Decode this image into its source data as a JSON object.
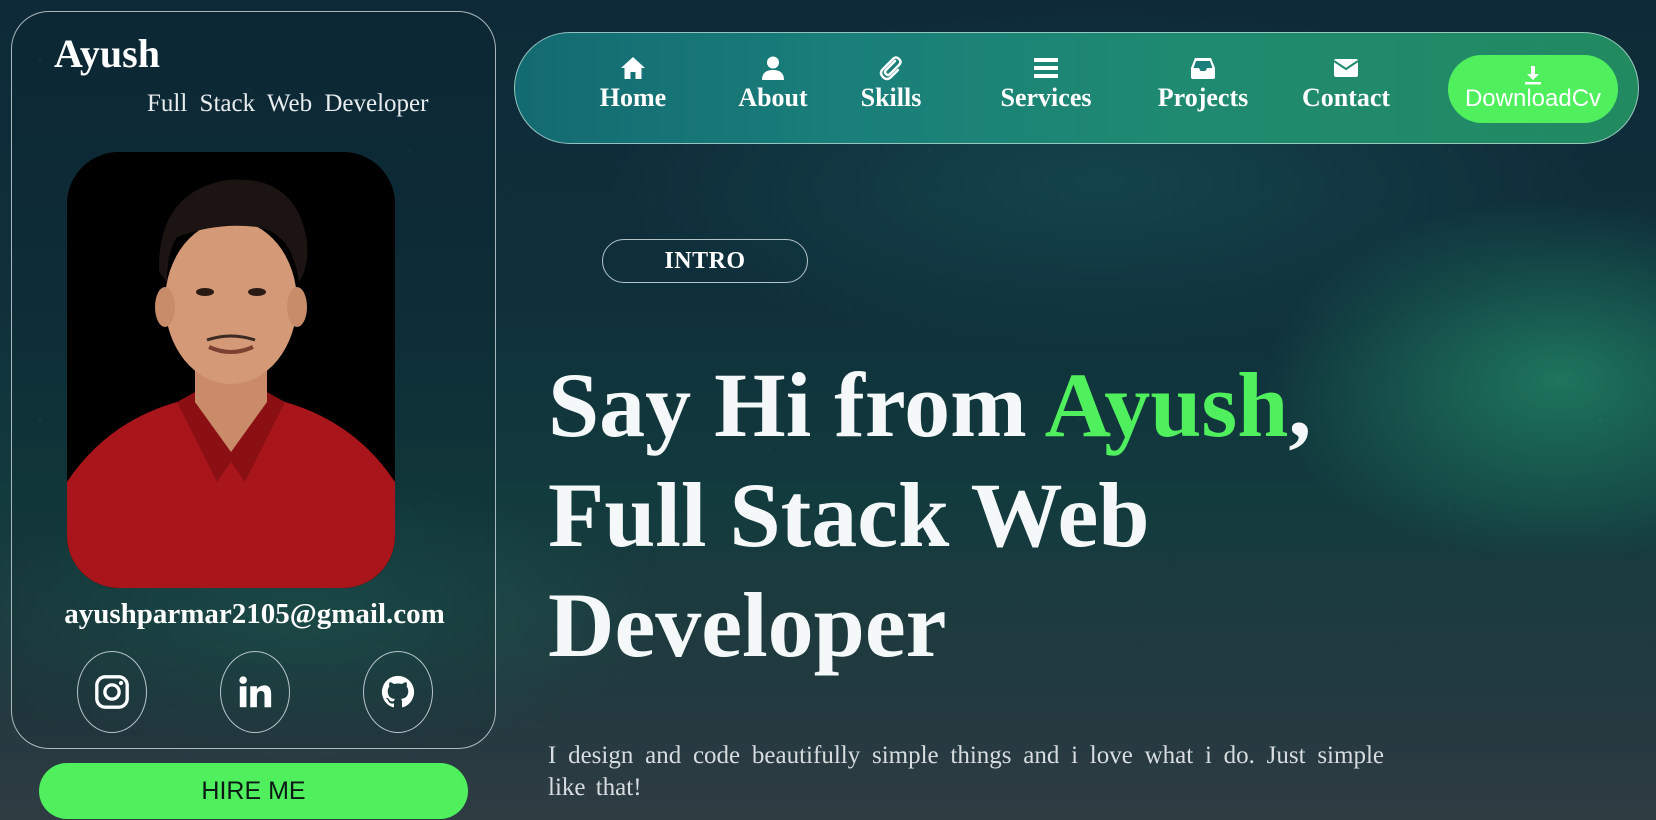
{
  "profile": {
    "name": "Ayush",
    "role": "Full Stack Web Developer",
    "email": "ayushparmar2105@gmail.com",
    "socials": [
      {
        "icon": "instagram-icon"
      },
      {
        "icon": "linkedin-icon"
      },
      {
        "icon": "github-icon"
      }
    ],
    "hire_label": "HIRE ME"
  },
  "nav": {
    "items": [
      {
        "label": "Home",
        "icon": "home-icon"
      },
      {
        "label": "About",
        "icon": "user-icon"
      },
      {
        "label": "Skills",
        "icon": "paperclip-icon"
      },
      {
        "label": "Services",
        "icon": "bars-icon"
      },
      {
        "label": "Projects",
        "icon": "inbox-icon"
      },
      {
        "label": "Contact",
        "icon": "envelope-icon"
      }
    ],
    "download_label": "DownloadCv",
    "download_icon": "download-icon"
  },
  "hero": {
    "tag": "INTRO",
    "title_prefix": "Say Hi from ",
    "title_name": "Ayush",
    "title_suffix_comma": ",",
    "title_line2": "Full Stack Web",
    "title_line3": "Developer",
    "description": "I design and code beautifully simple things and i love what i do. Just simple like that!"
  },
  "colors": {
    "accent": "#50ef5d",
    "nav_start": "#136a72",
    "nav_end": "#228a60",
    "background": "#0f2f3a"
  }
}
